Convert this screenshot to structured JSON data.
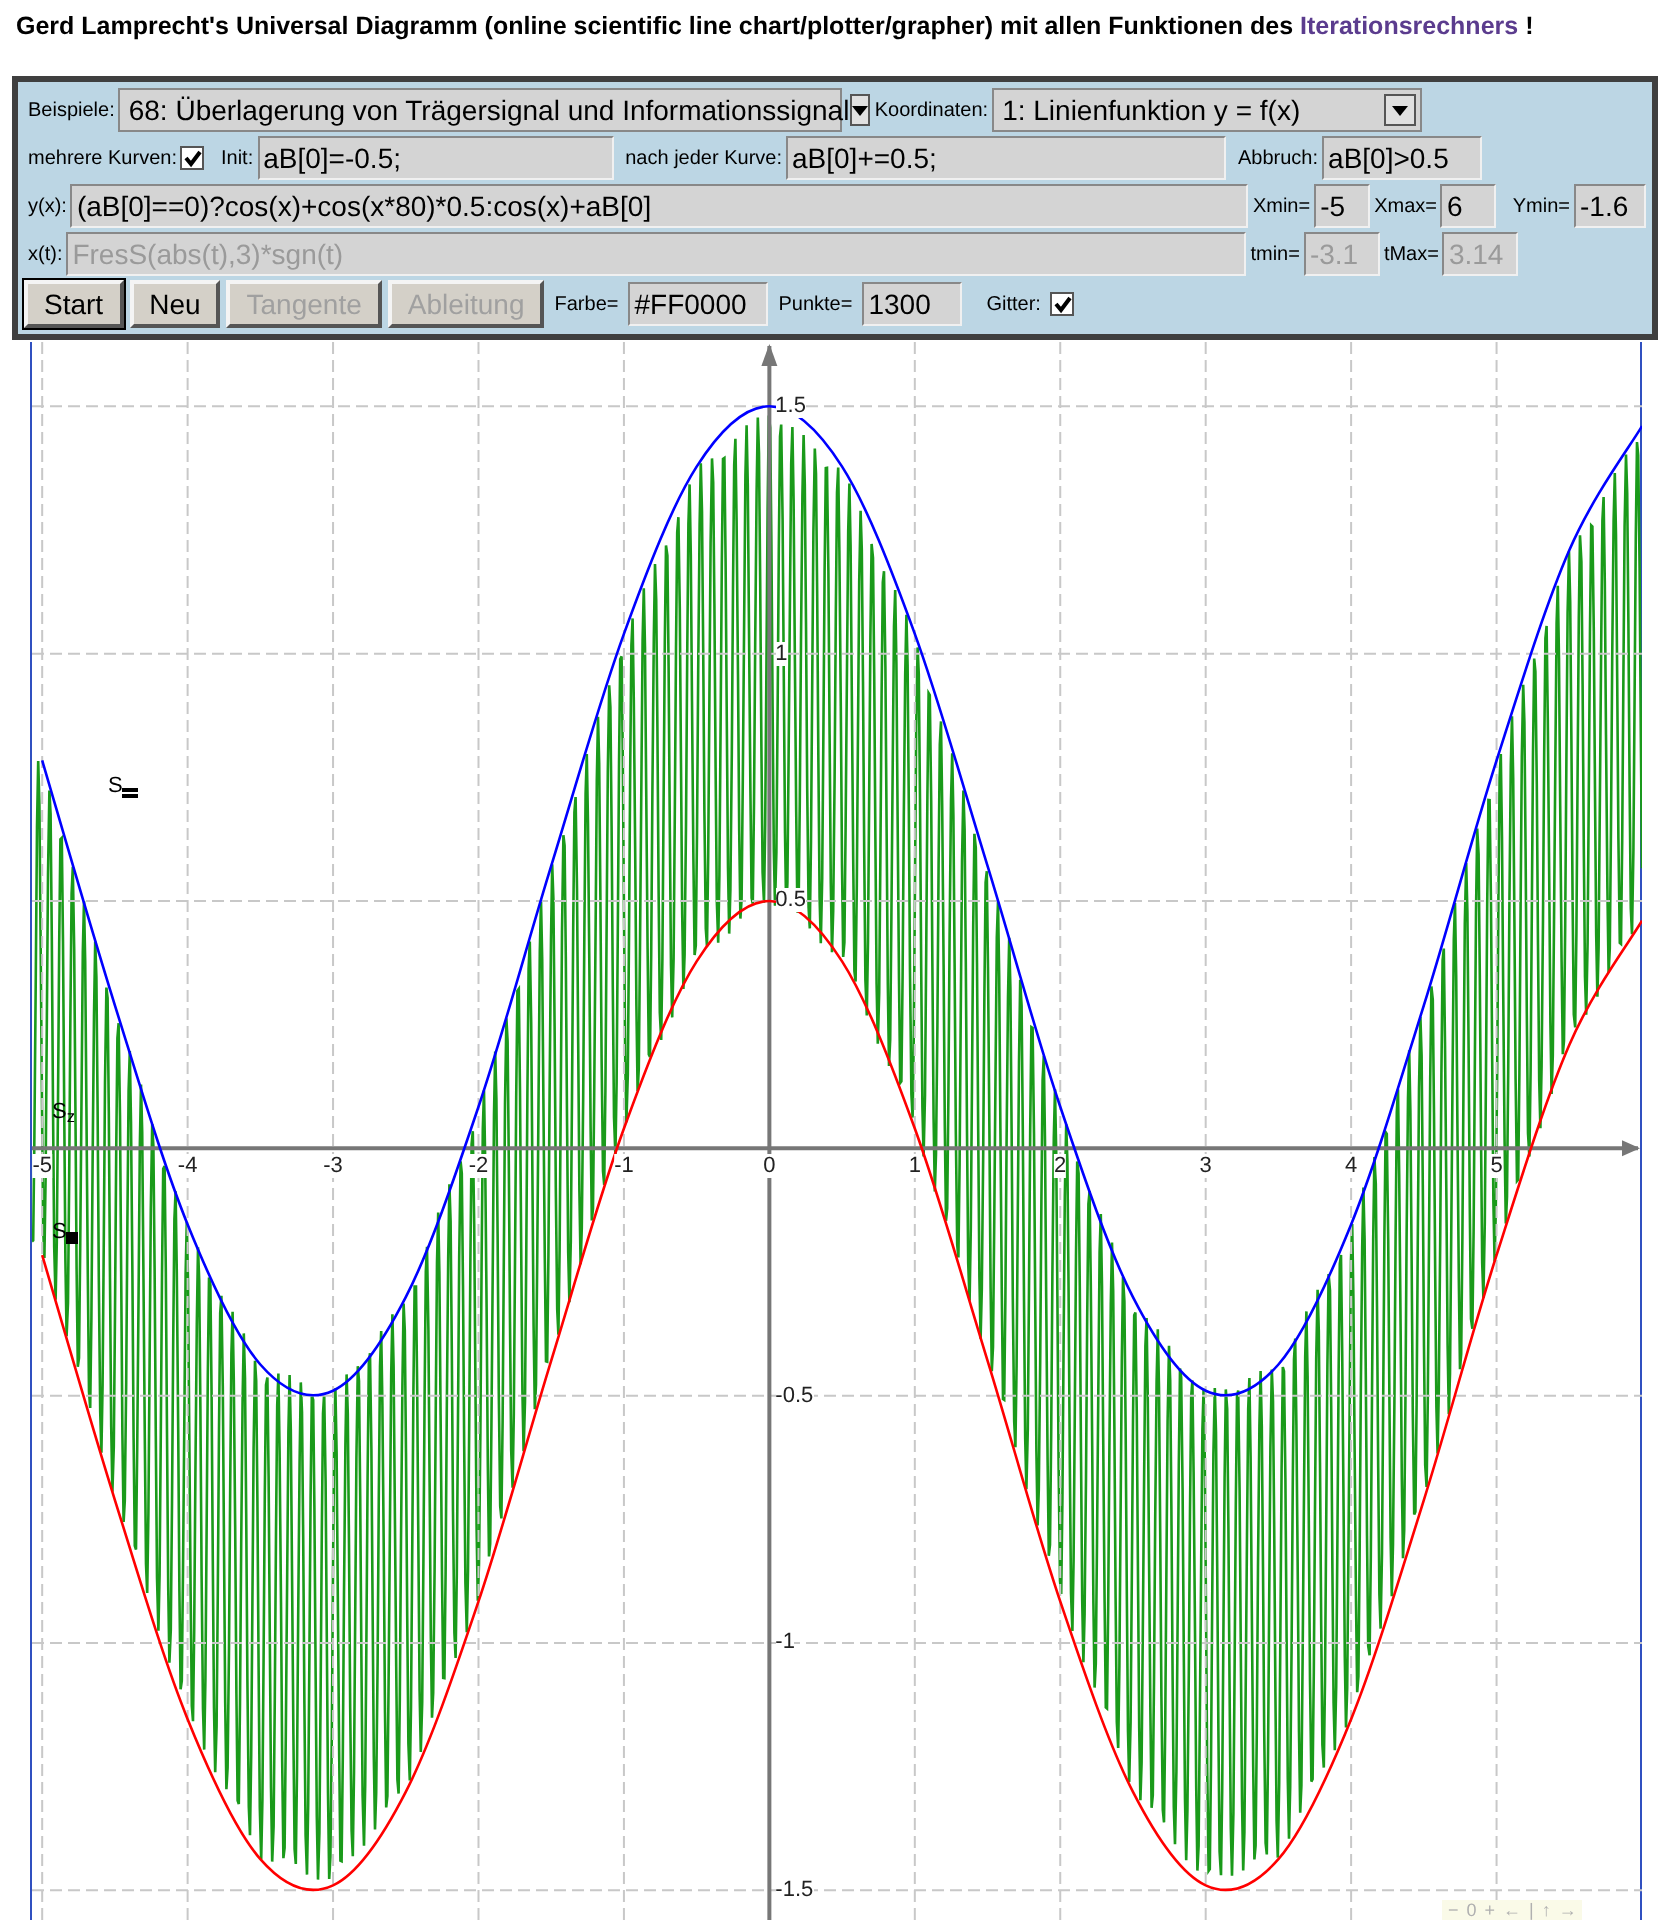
{
  "title": {
    "text": "Gerd Lamprecht's Universal Diagramm (online scientific line chart/plotter/grapher) mit allen Funktionen des ",
    "link": "Iterationsrechners",
    "end": "!"
  },
  "controls": {
    "beispiele": {
      "label": "Beispiele:",
      "value": "68: Überlagerung von Trägersignal und Informationssignal"
    },
    "koordinaten": {
      "label": "Koordinaten:",
      "value": "1: Linienfunktion y = f(x)"
    },
    "mehrere": {
      "label": "mehrere Kurven:",
      "checked": true
    },
    "init": {
      "label": "Init:",
      "value": "aB[0]=-0.5;",
      "disabled": false
    },
    "nach": {
      "label": "nach jeder Kurve:",
      "value": "aB[0]+=0.5;",
      "disabled": false
    },
    "abbruch": {
      "label": "Abbruch:",
      "value": "aB[0]>0.5",
      "disabled": false
    },
    "yx": {
      "label": "y(x):",
      "value": "(aB[0]==0)?cos(x)+cos(x*80)*0.5:cos(x)+aB[0]",
      "disabled": false
    },
    "xmin": {
      "label": "Xmin=",
      "value": "-5",
      "disabled": false
    },
    "xmax": {
      "label": "Xmax=",
      "value": "6",
      "disabled": false
    },
    "ymin": {
      "label": "Ymin=",
      "value": "-1.6",
      "disabled": false
    },
    "xt": {
      "label": "x(t):",
      "value": "FresS(abs(t),3)*sgn(t)",
      "disabled": true
    },
    "tmin": {
      "label": "tmin=",
      "value": "-3.1",
      "disabled": true
    },
    "tmax": {
      "label": "tMax=",
      "value": "3.14",
      "disabled": true
    },
    "buttons": [
      {
        "label": "Start",
        "disabled": false,
        "focused": true
      },
      {
        "label": "Neu",
        "disabled": false,
        "focused": false
      },
      {
        "label": "Tangente",
        "disabled": true,
        "focused": false
      },
      {
        "label": "Ableitung",
        "disabled": true,
        "focused": false
      }
    ],
    "farbe": {
      "label": "Farbe=",
      "value": "#FF0000",
      "disabled": false
    },
    "punkte": {
      "label": "Punkte=",
      "value": "1300",
      "disabled": false
    },
    "gitter": {
      "label": "Gitter:",
      "checked": true
    }
  },
  "plot": {
    "markers": [
      {
        "label": "S",
        "kind": "bars"
      },
      {
        "label": "S$_{z}$",
        "kind": "none"
      },
      {
        "label": "S",
        "kind": "square"
      }
    ],
    "toolbar": [
      "−",
      "0",
      "+",
      "←",
      "|",
      "↑",
      "→"
    ],
    "chart_data": {
      "type": "line",
      "grid": true,
      "xlim": [
        -5.07,
        6
      ],
      "ylim": [
        -1.56,
        1.63
      ],
      "xticks": [
        -5,
        -4,
        -3,
        -2,
        -1,
        0,
        1,
        2,
        3,
        4,
        5
      ],
      "yticks": [
        -1.5,
        -1,
        -0.5,
        0.5,
        1,
        1.5
      ],
      "x": [
        -5,
        -4.5,
        -4,
        -3.5,
        -3,
        -2.5,
        -2,
        -1.5,
        -1,
        -0.5,
        0,
        0.5,
        1,
        1.5,
        2,
        2.5,
        3,
        3.5,
        4,
        4.5,
        5,
        5.5,
        6
      ],
      "series": [
        {
          "color": "#0000ff",
          "values": [
            0.784,
            0.289,
            -0.154,
            -0.437,
            -0.49,
            -0.301,
            0.084,
            0.571,
            1.04,
            1.378,
            1.5,
            1.378,
            1.04,
            0.571,
            0.084,
            -0.301,
            -0.49,
            -0.437,
            -0.154,
            0.289,
            0.784,
            1.209,
            1.46
          ]
        },
        {
          "color": "#ff0000",
          "values": [
            -0.216,
            -0.711,
            -1.154,
            -1.437,
            -1.49,
            -1.301,
            -0.916,
            -0.429,
            0.04,
            0.378,
            0.5,
            0.378,
            0.04,
            -0.429,
            -0.916,
            -1.301,
            -1.49,
            -1.437,
            -1.154,
            -0.711,
            -0.216,
            0.209,
            0.46
          ]
        }
      ]
    }
  }
}
